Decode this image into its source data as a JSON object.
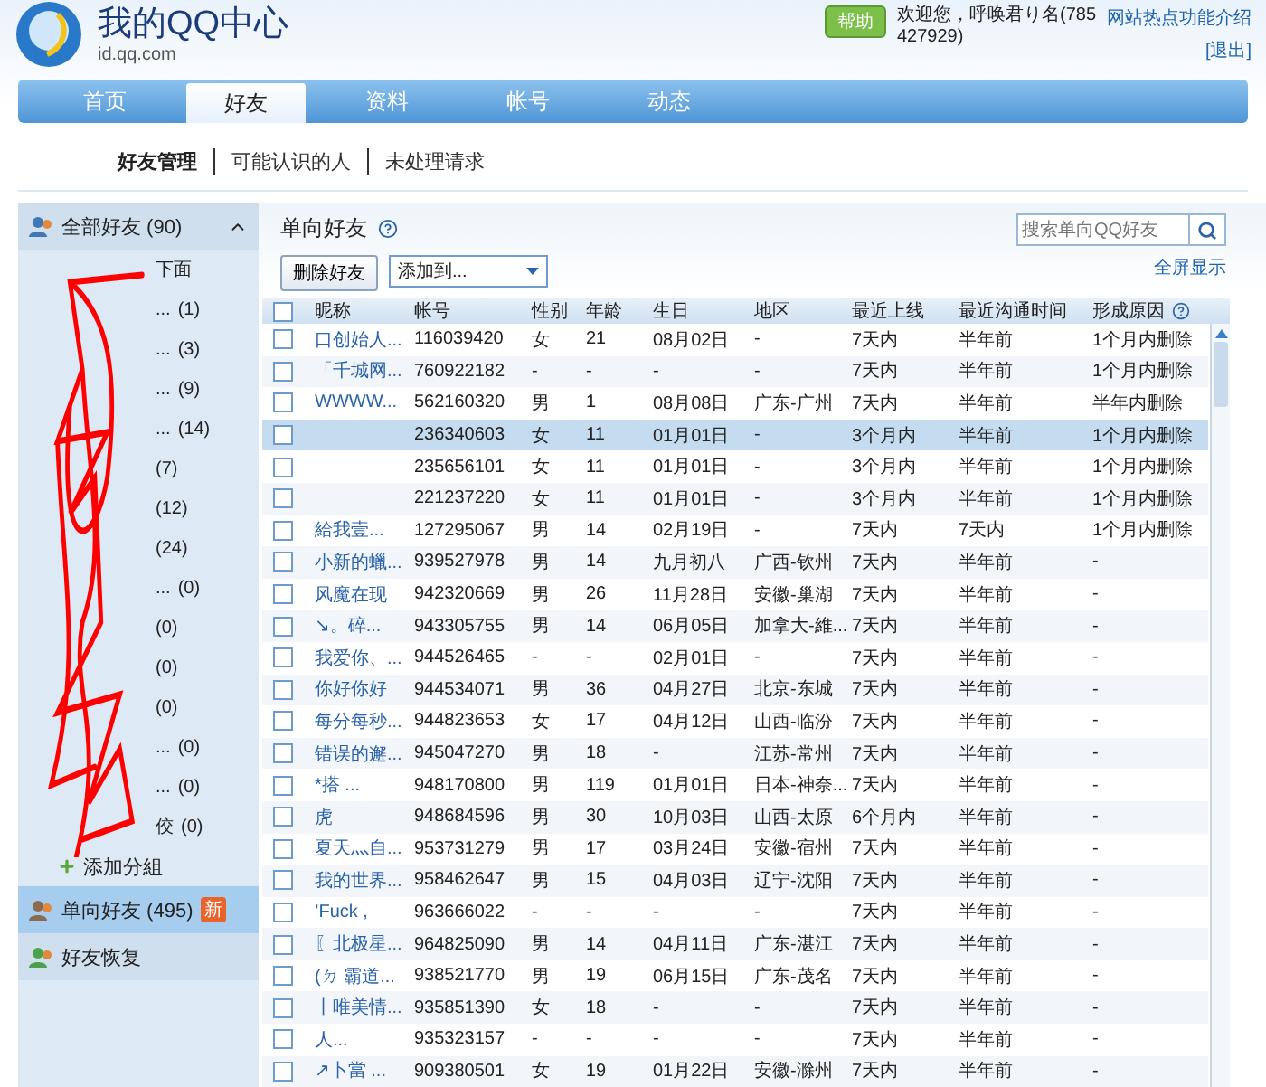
{
  "header": {
    "title": "我的QQ中心",
    "subtitle": "id.qq.com",
    "welcome": "欢迎您，呼唤君り名(785427929)",
    "logout": "[退出]",
    "help": "帮助",
    "intro_link": "网站热点功能介绍"
  },
  "nav": [
    {
      "label": "首页",
      "selected": false
    },
    {
      "label": "好友",
      "selected": true
    },
    {
      "label": "资料",
      "selected": false
    },
    {
      "label": "帐号",
      "selected": false
    },
    {
      "label": "动态",
      "selected": false
    }
  ],
  "subnav": [
    {
      "label": "好友管理",
      "selected": true
    },
    {
      "label": "可能认识的人",
      "selected": false
    },
    {
      "label": "未处理请求",
      "selected": false
    }
  ],
  "sidebar": [
    {
      "kind": "all",
      "label": "全部好友",
      "count": "(90)",
      "expanded": true,
      "selected": false,
      "add_label": "添加分組",
      "groups": [
        {
          "label": "下面"
        },
        {
          "label": "...",
          "count": "(1)"
        },
        {
          "label": "...",
          "count": "(3)"
        },
        {
          "label": "...",
          "count": "(9)"
        },
        {
          "label": "...",
          "count": "(14)"
        },
        {
          "count": "(7)"
        },
        {
          "count": "(12)"
        },
        {
          "count": "(24)"
        },
        {
          "label": "...",
          "count": "(0)"
        },
        {
          "count": "(0)"
        },
        {
          "count": "(0)"
        },
        {
          "count": "(0)"
        },
        {
          "label": "...",
          "count": "(0)"
        },
        {
          "label": "...",
          "count": "(0)"
        },
        {
          "label": "佼",
          "count": "(0)"
        }
      ]
    },
    {
      "kind": "oneway",
      "label": "单向好友",
      "count": "(495)",
      "badge": "新",
      "selected": true
    },
    {
      "kind": "restore",
      "label": "好友恢复",
      "selected": false
    }
  ],
  "panel": {
    "title": "单向好友",
    "delete_button": "删除好友",
    "add_to": "添加到...",
    "search": {
      "placeholder": "搜索单向QQ好友"
    },
    "fullscreen": "全屏显示"
  },
  "table": {
    "select_all": {
      "checked": false
    },
    "columns": [
      "昵称",
      "帐号",
      "性别",
      "年龄",
      "生日",
      "地区",
      "最近上线",
      "最近沟通时间",
      "形成原因"
    ],
    "rows": [
      {
        "nick": "口创始人...",
        "id": "116039420",
        "sex": "女",
        "age": "21",
        "birthday": "08月02日",
        "region": "-",
        "online": "7天内",
        "contact": "半年前",
        "reason": "1个月内删除",
        "selected": false,
        "checked": false
      },
      {
        "nick": "「千城网...",
        "id": "760922182",
        "sex": "-",
        "age": "-",
        "birthday": "-",
        "region": "-",
        "online": "7天内",
        "contact": "半年前",
        "reason": "1个月内删除",
        "selected": false,
        "checked": false
      },
      {
        "nick": "WWWW...",
        "id": "562160320",
        "sex": "男",
        "age": "1",
        "birthday": "08月08日",
        "region": "广东-广州",
        "online": "7天内",
        "contact": "半年前",
        "reason": "半年内删除",
        "selected": false,
        "checked": false
      },
      {
        "id": "236340603",
        "sex": "女",
        "age": "11",
        "birthday": "01月01日",
        "region": "-",
        "online": "3个月内",
        "contact": "半年前",
        "reason": "1个月内删除",
        "selected": true,
        "checked": false
      },
      {
        "id": "235656101",
        "sex": "女",
        "age": "11",
        "birthday": "01月01日",
        "region": "-",
        "online": "3个月内",
        "contact": "半年前",
        "reason": "1个月内删除",
        "selected": false,
        "checked": false
      },
      {
        "id": "221237220",
        "sex": "女",
        "age": "11",
        "birthday": "01月01日",
        "region": "-",
        "online": "3个月内",
        "contact": "半年前",
        "reason": "1个月内删除",
        "selected": false,
        "checked": false
      },
      {
        "nick": "給我壹...",
        "id": "127295067",
        "sex": "男",
        "age": "14",
        "birthday": "02月19日",
        "region": "-",
        "online": "7天内",
        "contact": "7天内",
        "reason": "1个月内删除",
        "selected": false,
        "checked": false
      },
      {
        "nick": "小新的蠟...",
        "id": "939527978",
        "sex": "男",
        "age": "14",
        "birthday": "九月初八",
        "region": "广西-钦州",
        "online": "7天内",
        "contact": "半年前",
        "reason": "-",
        "selected": false,
        "checked": false
      },
      {
        "nick": "风魔在现",
        "id": "942320669",
        "sex": "男",
        "age": "26",
        "birthday": "11月28日",
        "region": "安徽-巢湖",
        "online": "7天内",
        "contact": "半年前",
        "reason": "-",
        "selected": false,
        "checked": false
      },
      {
        "nick": "↘。碎...",
        "id": "943305755",
        "sex": "男",
        "age": "14",
        "birthday": "06月05日",
        "region": "加拿大-維...",
        "online": "7天内",
        "contact": "半年前",
        "reason": "-",
        "selected": false,
        "checked": false
      },
      {
        "nick": "我爱你、...",
        "id": "944526465",
        "sex": "-",
        "age": "-",
        "birthday": "02月01日",
        "region": "-",
        "online": "7天内",
        "contact": "半年前",
        "reason": "-",
        "selected": false,
        "checked": false
      },
      {
        "nick": "你好你好",
        "id": "944534071",
        "sex": "男",
        "age": "36",
        "birthday": "04月27日",
        "region": "北京-东城",
        "online": "7天内",
        "contact": "半年前",
        "reason": "-",
        "selected": false,
        "checked": false
      },
      {
        "nick": "每分每秒...",
        "id": "944823653",
        "sex": "女",
        "age": "17",
        "birthday": "04月12日",
        "region": "山西-临汾",
        "online": "7天内",
        "contact": "半年前",
        "reason": "-",
        "selected": false,
        "checked": false
      },
      {
        "nick": "错误的邂...",
        "id": "945047270",
        "sex": "男",
        "age": "18",
        "birthday": "-",
        "region": "江苏-常州",
        "online": "7天内",
        "contact": "半年前",
        "reason": "-",
        "selected": false,
        "checked": false
      },
      {
        "nick": "*搭 ...",
        "id": "948170800",
        "sex": "男",
        "age": "119",
        "birthday": "01月01日",
        "region": "日本-神奈...",
        "online": "7天内",
        "contact": "半年前",
        "reason": "-",
        "selected": false,
        "checked": false
      },
      {
        "nick": "虎",
        "id": "948684596",
        "sex": "男",
        "age": "30",
        "birthday": "10月03日",
        "region": "山西-太原",
        "online": "6个月内",
        "contact": "半年前",
        "reason": "-",
        "selected": false,
        "checked": false
      },
      {
        "nick": "夏天灬自...",
        "id": "953731279",
        "sex": "男",
        "age": "17",
        "birthday": "03月24日",
        "region": "安徽-宿州",
        "online": "7天内",
        "contact": "半年前",
        "reason": "-",
        "selected": false,
        "checked": false
      },
      {
        "nick": "我的世界...",
        "id": "958462647",
        "sex": "男",
        "age": "15",
        "birthday": "04月03日",
        "region": "辽宁-沈阳",
        "online": "7天内",
        "contact": "半年前",
        "reason": "-",
        "selected": false,
        "checked": false
      },
      {
        "nick": "’Fuck ,",
        "id": "963666022",
        "sex": "-",
        "age": "-",
        "birthday": "-",
        "region": "-",
        "online": "7天内",
        "contact": "半年前",
        "reason": "-",
        "selected": false,
        "checked": false
      },
      {
        "nick": "〖北极星...",
        "id": "964825090",
        "sex": "男",
        "age": "14",
        "birthday": "04月11日",
        "region": "广东-湛江",
        "online": "7天内",
        "contact": "半年前",
        "reason": "-",
        "selected": false,
        "checked": false
      },
      {
        "nick": "(ㄉ 霸道...",
        "id": "938521770",
        "sex": "男",
        "age": "19",
        "birthday": "06月15日",
        "region": "广东-茂名",
        "online": "7天内",
        "contact": "半年前",
        "reason": "-",
        "selected": false,
        "checked": false
      },
      {
        "nick": "丨唯美情...",
        "id": "935851390",
        "sex": "女",
        "age": "18",
        "birthday": "-",
        "region": "-",
        "online": "7天内",
        "contact": "半年前",
        "reason": "-",
        "selected": false,
        "checked": false
      },
      {
        "nick": "人...",
        "id": "935323157",
        "sex": "-",
        "age": "-",
        "birthday": "-",
        "region": "-",
        "online": "7天内",
        "contact": "半年前",
        "reason": "-",
        "selected": false,
        "checked": false
      },
      {
        "nick": "↗卜當 ...",
        "id": "909380501",
        "sex": "女",
        "age": "19",
        "birthday": "01月22日",
        "region": "安徽-滁州",
        "online": "7天内",
        "contact": "半年前",
        "reason": "-",
        "selected": false,
        "checked": false
      }
    ]
  }
}
